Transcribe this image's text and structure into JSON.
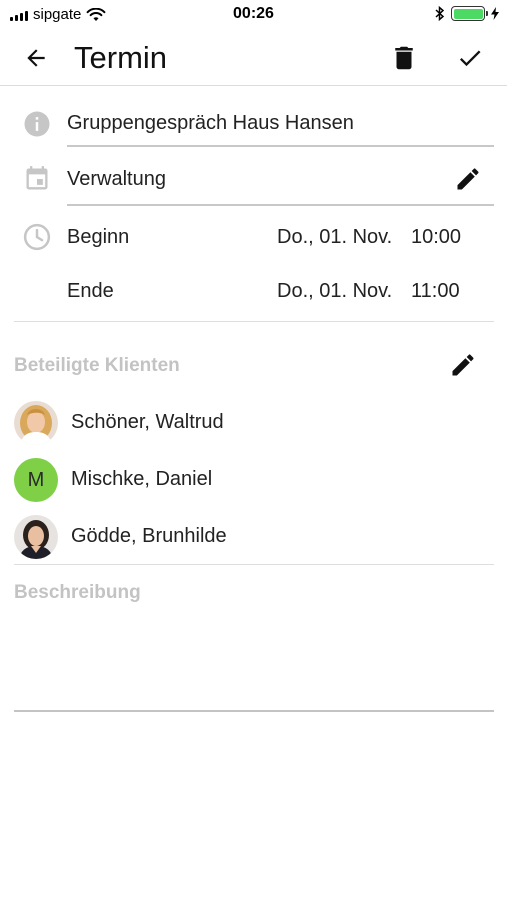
{
  "status_bar": {
    "carrier": "sipgate",
    "time": "00:26"
  },
  "app_bar": {
    "title": "Termin"
  },
  "appointment": {
    "title": "Gruppengespräch Haus Hansen",
    "category": "Verwaltung",
    "begin_label": "Beginn",
    "begin_date": "Do., 01. Nov.",
    "begin_time": "10:00",
    "end_label": "Ende",
    "end_date": "Do., 01. Nov.",
    "end_time": "11:00"
  },
  "clients_section": {
    "header": "Beteiligte Klienten",
    "clients": [
      {
        "name": "Schöner, Waltrud",
        "avatar": "photo"
      },
      {
        "name": "Mischke, Daniel",
        "avatar": "letter",
        "initial": "M",
        "color": "#7fcf47"
      },
      {
        "name": "Gödde, Brunhilde",
        "avatar": "photo"
      }
    ]
  },
  "description_section": {
    "header": "Beschreibung"
  },
  "icons": {
    "back": "arrow-back-icon",
    "delete": "trash-icon",
    "confirm": "check-icon",
    "info": "info-icon",
    "calendar": "calendar-icon",
    "clock": "clock-icon",
    "edit": "pencil-icon"
  },
  "colors": {
    "battery": "#4cd964",
    "avatar_letter_bg": "#7fcf47",
    "section_header": "#c3c3c3",
    "icon_gray": "#c6c6c6"
  }
}
